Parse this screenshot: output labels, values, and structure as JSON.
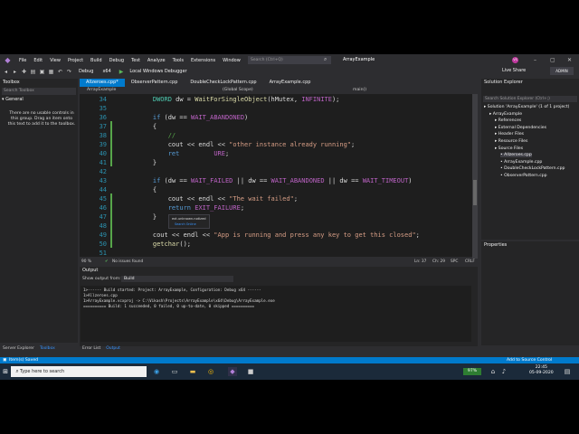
{
  "menu": {
    "items": [
      "File",
      "Edit",
      "View",
      "Project",
      "Build",
      "Debug",
      "Test",
      "Analyze",
      "Tools",
      "Extensions",
      "Window",
      "Help"
    ],
    "search_placeholder": "Search (Ctrl+Q)",
    "solution_name": "ArrayExample",
    "avatar_initials": "VS"
  },
  "toolbar": {
    "config": "Debug",
    "platform": "x64",
    "run_label": "Local Windows Debugger",
    "live_share": "Live Share",
    "admin": "ADMIN"
  },
  "toolbox": {
    "title": "Toolbox",
    "search_placeholder": "Search Toolbox",
    "group": "General",
    "message": "There are no usable controls in this group. Drag an item onto this text to add it to the toolbox.",
    "tabs": [
      "Server Explorer",
      "Toolbox"
    ]
  },
  "editor": {
    "tabs": [
      "Allzeroes.cpp*",
      "ObserverPattern.cpp",
      "DoubleCheckLockPattern.cpp",
      "ArrayExample.cpp"
    ],
    "nav": {
      "project": "ArrayExample",
      "scope": "(Global Scope)",
      "func": "main()"
    },
    "line_numbers": [
      "34",
      "35",
      "36",
      "37",
      "38",
      "39",
      "40",
      "41",
      "42",
      "43",
      "44",
      "45",
      "46",
      "47",
      "48",
      "49",
      "50",
      "51"
    ],
    "lines": [
      {
        "indent": "    ",
        "parts": [
          {
            "t": "DWORD ",
            "c": "ty"
          },
          {
            "t": "dw = ",
            "c": ""
          },
          {
            "t": "WaitForSingleObject",
            "c": "fn"
          },
          {
            "t": "(hMutex, ",
            "c": ""
          },
          {
            "t": "INFINITE",
            "c": "mac"
          },
          {
            "t": ");",
            "c": ""
          }
        ]
      },
      {
        "indent": "",
        "parts": []
      },
      {
        "indent": "    ",
        "parts": [
          {
            "t": "if ",
            "c": "kw"
          },
          {
            "t": "(dw == ",
            "c": ""
          },
          {
            "t": "WAIT_ABANDONED",
            "c": "mac"
          },
          {
            "t": ")",
            "c": ""
          }
        ]
      },
      {
        "indent": "    ",
        "parts": [
          {
            "t": "{",
            "c": ""
          }
        ]
      },
      {
        "indent": "        ",
        "parts": [
          {
            "t": "//",
            "c": "cm"
          }
        ]
      },
      {
        "indent": "        ",
        "parts": [
          {
            "t": "cout << endl << ",
            "c": ""
          },
          {
            "t": "\"other instance already running\"",
            "c": "str"
          },
          {
            "t": ";",
            "c": ""
          }
        ]
      },
      {
        "indent": "        ",
        "parts": [
          {
            "t": "ret",
            "c": "kw"
          },
          {
            "t": "         ",
            "c": ""
          },
          {
            "t": "URE",
            "c": "mac"
          },
          {
            "t": ";",
            "c": ""
          }
        ]
      },
      {
        "indent": "    ",
        "parts": [
          {
            "t": "}",
            "c": ""
          }
        ]
      },
      {
        "indent": "",
        "parts": []
      },
      {
        "indent": "    ",
        "parts": [
          {
            "t": "if ",
            "c": "kw"
          },
          {
            "t": "(dw == ",
            "c": ""
          },
          {
            "t": "WAIT_FAILED",
            "c": "mac"
          },
          {
            "t": " || dw == ",
            "c": ""
          },
          {
            "t": "WAIT_ABANDONED",
            "c": "mac"
          },
          {
            "t": " || dw == ",
            "c": ""
          },
          {
            "t": "WAIT_TIMEOUT",
            "c": "mac"
          },
          {
            "t": ")",
            "c": ""
          }
        ]
      },
      {
        "indent": "    ",
        "parts": [
          {
            "t": "{",
            "c": ""
          }
        ]
      },
      {
        "indent": "        ",
        "parts": [
          {
            "t": "cout << endl << ",
            "c": ""
          },
          {
            "t": "\"The wait failed\"",
            "c": "str"
          },
          {
            "t": ";",
            "c": ""
          }
        ]
      },
      {
        "indent": "        ",
        "parts": [
          {
            "t": "return ",
            "c": "kw"
          },
          {
            "t": "EXIT_FAILURE",
            "c": "mac"
          },
          {
            "t": ";",
            "c": ""
          }
        ]
      },
      {
        "indent": "    ",
        "parts": [
          {
            "t": "}",
            "c": ""
          }
        ]
      },
      {
        "indent": "",
        "parts": []
      },
      {
        "indent": "    ",
        "parts": [
          {
            "t": "cout << endl << ",
            "c": ""
          },
          {
            "t": "\"App is running and press any key to get this closed\"",
            "c": "str"
          },
          {
            "t": ";",
            "c": ""
          }
        ]
      },
      {
        "indent": "    ",
        "parts": [
          {
            "t": "getchar",
            "c": "fn"
          },
          {
            "t": "();",
            "c": ""
          }
        ]
      }
    ],
    "tooltip": {
      "line1": "ext.unknown.notized",
      "line2": "Search Online"
    },
    "status": {
      "zoom": "90 %",
      "issues": "No issues found",
      "ln": "Ln: 37",
      "ch": "Ch: 29",
      "spc": "SPC",
      "crlf": "CRLF"
    }
  },
  "output": {
    "title": "Output",
    "show_from_label": "Show output from:",
    "source": "Build",
    "lines": [
      "1>------ Build started: Project: ArrayExample, Configuration: Debug x64 ------",
      "1>Allzeroes.cpp",
      "1>ArrayExample.vcxproj -> C:\\Vikash\\Projects\\ArrayExample\\x64\\Debug\\ArrayExample.exe",
      "========== Build: 1 succeeded, 0 failed, 0 up-to-date, 0 skipped =========="
    ],
    "tabs": [
      "Error List",
      "Output"
    ]
  },
  "solution": {
    "title": "Solution Explorer",
    "search_placeholder": "Search Solution Explorer (Ctrl+;)",
    "items": [
      {
        "label": "Solution 'ArrayExample' (1 of 1 project)",
        "depth": 0,
        "sel": false
      },
      {
        "label": "ArrayExample",
        "depth": 1,
        "sel": false
      },
      {
        "label": "References",
        "depth": 2,
        "sel": false
      },
      {
        "label": "External Dependencies",
        "depth": 2,
        "sel": false
      },
      {
        "label": "Header Files",
        "depth": 2,
        "sel": false
      },
      {
        "label": "Resource Files",
        "depth": 2,
        "sel": false
      },
      {
        "label": "Source Files",
        "depth": 2,
        "sel": false
      },
      {
        "label": "Allzeroes.cpp",
        "depth": 3,
        "sel": true
      },
      {
        "label": "ArrayExample.cpp",
        "depth": 3,
        "sel": false
      },
      {
        "label": "DoubleCheckLockPattern.cpp",
        "depth": 3,
        "sel": false
      },
      {
        "label": "ObserverPattern.cpp",
        "depth": 3,
        "sel": false
      }
    ]
  },
  "properties": {
    "title": "Properties"
  },
  "status_bar": {
    "left": "Item(s) Saved",
    "right": "Add to Source Control"
  },
  "taskbar": {
    "search_placeholder": "Type here to search",
    "battery": "97%",
    "time": "22:45",
    "date": "05-09-2020"
  }
}
